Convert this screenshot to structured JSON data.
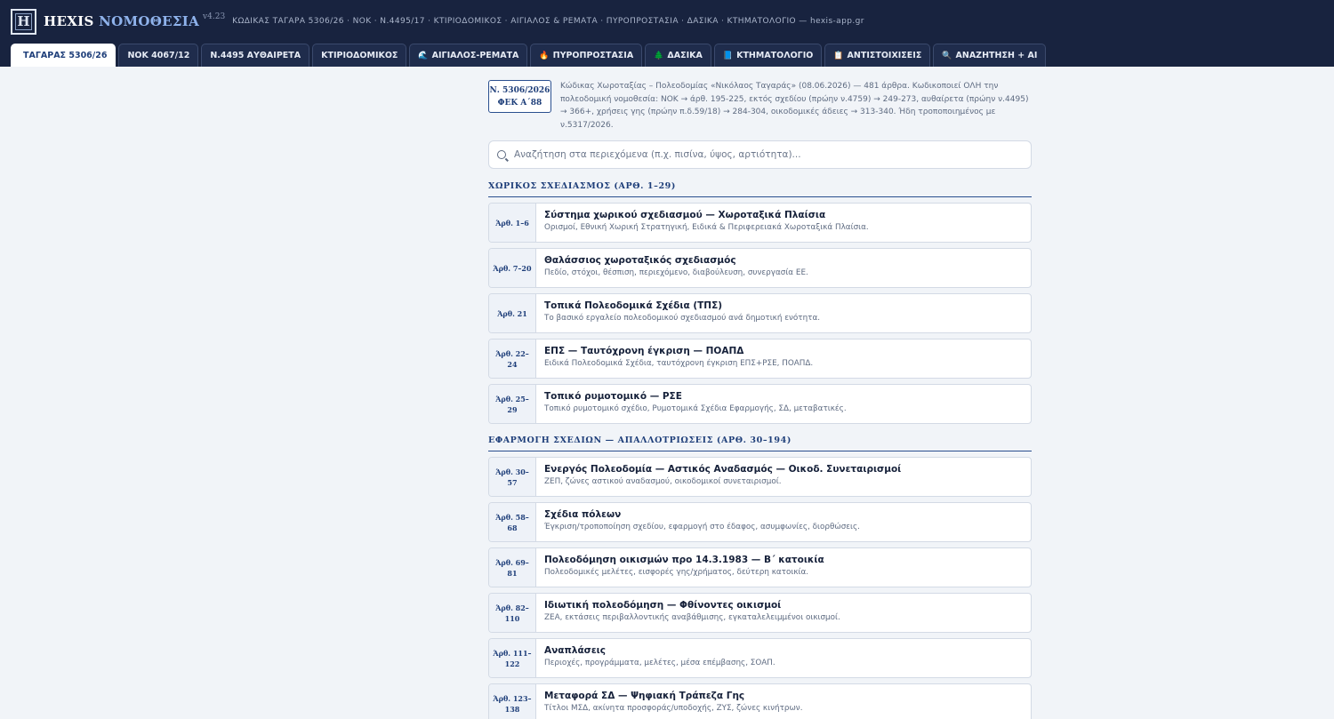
{
  "header": {
    "logo_glyph": "H",
    "brand_part1": "HEXIS",
    "brand_part2": "ΝΟΜΟΘΕΣΙΑ",
    "version": "v4.23",
    "subtitle": "ΚΩΔΙΚΑΣ ΤΑΓΑΡΑ 5306/26 · ΝΟΚ · Ν.4495/17 · ΚΤΙΡΙΟΔΟΜΙΚΟΣ · ΑΙΓΙΑΛΟΣ & ΡΕΜΑΤΑ · ΠΥΡΟΠΡΟΣΤΑΣΙΑ · ΔΑΣΙΚΑ · ΚΤΗΜΑΤΟΛΟΓΙΟ — hexis-app.gr"
  },
  "tabs": [
    {
      "label": "ΤΑΓΑΡΑΣ 5306/26",
      "icon": "",
      "active": true
    },
    {
      "label": "ΝΟΚ 4067/12",
      "icon": ""
    },
    {
      "label": "Ν.4495 ΑΥΘΑΙΡΕΤΑ",
      "icon": ""
    },
    {
      "label": "ΚΤΙΡΙΟΔΟΜΙΚΟΣ",
      "icon": ""
    },
    {
      "label": "ΑΙΓΙΑΛΟΣ-ΡΕΜΑΤΑ",
      "icon": "🌊"
    },
    {
      "label": "ΠΥΡΟΠΡΟΣΤΑΣΙΑ",
      "icon": "🔥"
    },
    {
      "label": "ΔΑΣΙΚΑ",
      "icon": "🌲"
    },
    {
      "label": "ΚΤΗΜΑΤΟΛΟΓΙΟ",
      "icon": "📘"
    },
    {
      "label": "ΑΝΤΙΣΤΟΙΧΙΣΕΙΣ",
      "icon": "📋"
    },
    {
      "label": "ΑΝΑΖΗΤΗΣΗ + AI",
      "icon": "🔍"
    }
  ],
  "law": {
    "badge_line1": "Ν. 5306/2026",
    "badge_line2": "ΦΕΚ Α΄88",
    "description": "Κώδικας Χωροταξίας – Πολεοδομίας «Νικόλαος Ταγαράς» (08.06.2026) — 481 άρθρα. Κωδικοποιεί ΟΛΗ την πολεοδομική νομοθεσία: ΝΟΚ → άρθ. 195-225, εκτός σχεδίου (πρώην ν.4759) → 249-273, αυθαίρετα (πρώην ν.4495) → 366+, χρήσεις γης (πρώην π.δ.59/18) → 284-304, οικοδομικές άδειες → 313-340. Ήδη τροποποιημένος με ν.5317/2026."
  },
  "search": {
    "placeholder": "Αναζήτηση στα περιεχόμενα (π.χ. πισίνα, ύψος, αρτιότητα)...",
    "value": ""
  },
  "sections": [
    {
      "title": "ΧΩΡΙΚΟΣ ΣΧΕΔΙΑΣΜΟΣ (ΑΡΘ. 1–29)",
      "items": [
        {
          "num": "Άρθ. 1–6",
          "title": "Σύστημα χωρικού σχεδιασμού — Χωροταξικά Πλαίσια",
          "sub": "Ορισμοί, Εθνική Χωρική Στρατηγική, Ειδικά & Περιφερειακά Χωροταξικά Πλαίσια."
        },
        {
          "num": "Άρθ. 7–20",
          "title": "Θαλάσσιος χωροταξικός σχεδιασμός",
          "sub": "Πεδίο, στόχοι, θέσπιση, περιεχόμενο, διαβούλευση, συνεργασία ΕΕ."
        },
        {
          "num": "Άρθ. 21",
          "title": "Τοπικά Πολεοδομικά Σχέδια (ΤΠΣ)",
          "sub": "Το βασικό εργαλείο πολεοδομικού σχεδιασμού ανά δημοτική ενότητα."
        },
        {
          "num": "Άρθ. 22–24",
          "title": "ΕΠΣ — Ταυτόχρονη έγκριση — ΠΟΑΠΔ",
          "sub": "Ειδικά Πολεοδομικά Σχέδια, ταυτόχρονη έγκριση ΕΠΣ+ΡΣΕ, ΠΟΑΠΔ."
        },
        {
          "num": "Άρθ. 25–29",
          "title": "Τοπικό ρυμοτομικό — ΡΣΕ",
          "sub": "Τοπικό ρυμοτομικό σχέδιο, Ρυμοτομικά Σχέδια Εφαρμογής, ΣΔ, μεταβατικές."
        }
      ]
    },
    {
      "title": "ΕΦΑΡΜΟΓΗ ΣΧΕΔΙΩΝ — ΑΠΑΛΛΟΤΡΙΩΣΕΙΣ (ΑΡΘ. 30–194)",
      "items": [
        {
          "num": "Άρθ. 30–57",
          "title": "Ενεργός Πολεοδομία — Αστικός Αναδασμός — Οικοδ. Συνεταιρισμοί",
          "sub": "ΖΕΠ, ζώνες αστικού αναδασμού, οικοδομικοί συνεταιρισμοί."
        },
        {
          "num": "Άρθ. 58–68",
          "title": "Σχέδια πόλεων",
          "sub": "Έγκριση/τροποποίηση σχεδίου, εφαρμογή στο έδαφος, ασυμφωνίες, διορθώσεις."
        },
        {
          "num": "Άρθ. 69–81",
          "title": "Πολεοδόμηση οικισμών προ 14.3.1983 — Β΄ κατοικία",
          "sub": "Πολεοδομικές μελέτες, εισφορές γης/χρήματος, δεύτερη κατοικία."
        },
        {
          "num": "Άρθ. 82–110",
          "title": "Ιδιωτική πολεοδόμηση — Φθίνοντες οικισμοί",
          "sub": "ΖΕΑ, εκτάσεις περιβαλλοντικής αναβάθμισης, εγκαταλελειμμένοι οικισμοί."
        },
        {
          "num": "Άρθ. 111–122",
          "title": "Αναπλάσεις",
          "sub": "Περιοχές, προγράμματα, μελέτες, μέσα επέμβασης, ΣΟΑΠ."
        },
        {
          "num": "Άρθ. 123–138",
          "title": "Μεταφορά ΣΔ — Ψηφιακή Τράπεζα Γης",
          "sub": "Τίτλοι ΜΣΔ, ακίνητα προσφοράς/υποδοχής, ΖΥΣ, ζώνες κινήτρων."
        }
      ]
    }
  ],
  "colors": {
    "header_bg": "#18233f",
    "accent": "#1f3f7a",
    "brand_accent": "#8fb3ec"
  }
}
